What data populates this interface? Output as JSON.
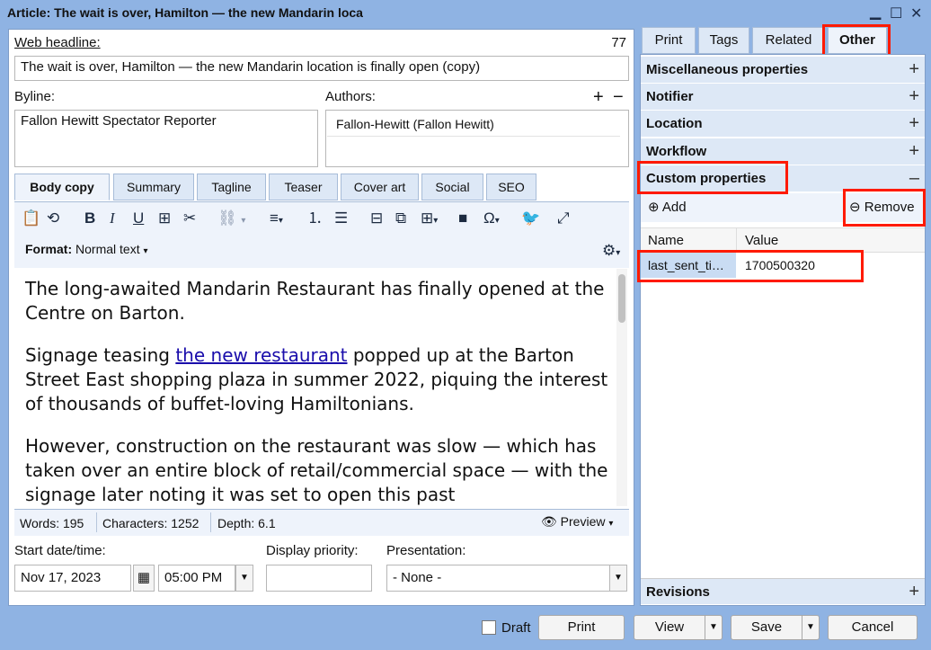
{
  "window": {
    "title": "Article: The wait is over, Hamilton — the new Mandarin loca"
  },
  "headline": {
    "label": "Web headline:",
    "count": "77",
    "value": "The wait is over, Hamilton — the new Mandarin location is finally open (copy)"
  },
  "byline": {
    "label": "Byline:",
    "value": "Fallon Hewitt Spectator Reporter"
  },
  "authors": {
    "label": "Authors:",
    "add": "+",
    "remove": "−",
    "value": "Fallon-Hewitt (Fallon Hewitt)"
  },
  "editor_tabs": [
    "Body copy",
    "Summary",
    "Tagline",
    "Teaser",
    "Cover art",
    "Social",
    "SEO"
  ],
  "format": {
    "label": "Format:",
    "value": "Normal text"
  },
  "body": {
    "p1": "The long-awaited Mandarin Restaurant has finally opened at the Centre on Barton.",
    "p2_before": "Signage teasing ",
    "p2_link": "the new restaurant",
    "p2_after": " popped up at the Barton Street East shopping plaza in summer 2022, piquing the interest of thousands of buffet-loving Hamiltonians.",
    "p3": "However, construction on the restaurant was slow — which has taken over an entire block of retail/commercial space — with the signage later noting it was set to open this past"
  },
  "stats": {
    "words": "Words: 195",
    "characters": "Characters: 1252",
    "depth": "Depth: 6.1",
    "preview": "Preview"
  },
  "schedule": {
    "start_label": "Start date/time:",
    "date": "Nov 17, 2023",
    "time": "05:00 PM",
    "priority_label": "Display priority:",
    "priority_value": "",
    "presentation_label": "Presentation:",
    "presentation_value": "- None -"
  },
  "right_tabs": [
    "Print",
    "Tags",
    "Related",
    "Other"
  ],
  "sections": {
    "misc": "Miscellaneous properties",
    "notifier": "Notifier",
    "location": "Location",
    "workflow": "Workflow",
    "custom": "Custom properties",
    "revisions": "Revisions"
  },
  "custom_props": {
    "add": "Add",
    "remove": "Remove",
    "col_name": "Name",
    "col_value": "Value",
    "rows": [
      {
        "name": "last_sent_ti…",
        "value": "1700500320"
      }
    ]
  },
  "footer": {
    "draft": "Draft",
    "print": "Print",
    "view": "View",
    "save": "Save",
    "cancel": "Cancel"
  },
  "colors": {
    "frame": "#8fb3e3",
    "highlight": "#ff1a00",
    "section_bg": "#dde8f6"
  }
}
